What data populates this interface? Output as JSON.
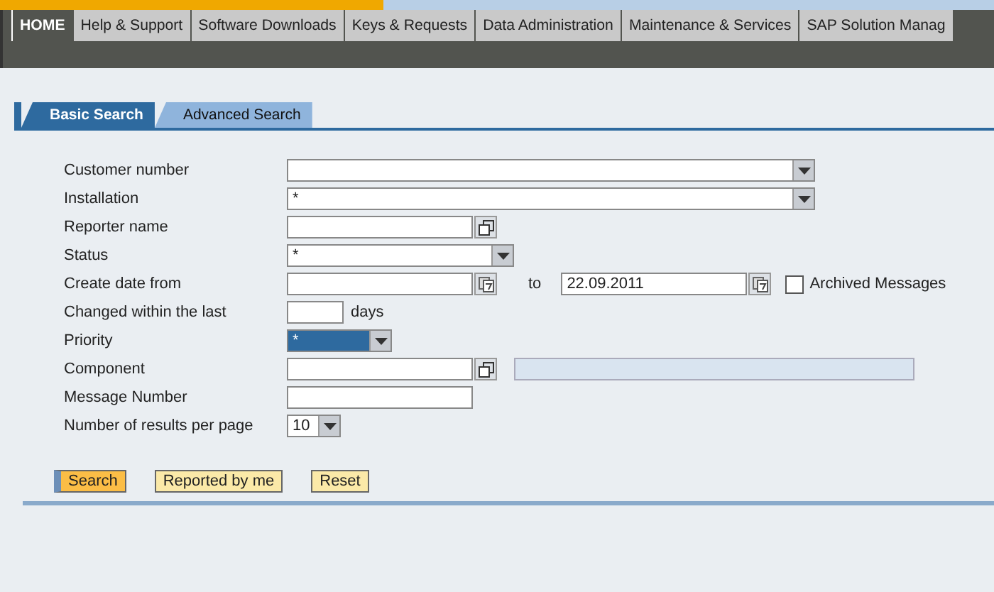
{
  "nav_tabs": [
    {
      "label": "HOME",
      "selected": true
    },
    {
      "label": "Help & Support",
      "selected": false
    },
    {
      "label": "Software Downloads",
      "selected": false
    },
    {
      "label": "Keys & Requests",
      "selected": false
    },
    {
      "label": "Data Administration",
      "selected": false
    },
    {
      "label": "Maintenance & Services",
      "selected": false
    },
    {
      "label": "SAP Solution Manag",
      "selected": false
    }
  ],
  "search_tabs": [
    {
      "label": "Basic Search",
      "selected": true
    },
    {
      "label": "Advanced Search",
      "selected": false
    }
  ],
  "form_rows": [
    {
      "label": "Customer number",
      "kind": "wide-combo",
      "focused": false
    },
    {
      "label": "Installation",
      "kind": "wide-combo",
      "value": "*",
      "focused": false
    },
    {
      "label": "Reporter name",
      "kind": "help",
      "focused": false
    },
    {
      "label": "Status",
      "kind": "combo",
      "value": "*",
      "focused": false
    },
    {
      "label": "Create date from",
      "kind": "date-range",
      "to_label": "to",
      "to_value": "22.09.2011",
      "checkbox": {
        "label": "Archived Messages",
        "checked": false
      },
      "focused": false
    },
    {
      "label": "Changed within the last",
      "kind": "days",
      "unit": "days",
      "focused": false
    },
    {
      "label": "Priority",
      "kind": "small-combo",
      "value": "*",
      "focused": true
    },
    {
      "label": "Component",
      "kind": "help-description",
      "focused": false
    },
    {
      "label": "Message Number",
      "kind": "text",
      "focused": false
    },
    {
      "label": "Number of results per page",
      "kind": "tiny-combo",
      "value": "10",
      "focused": false
    }
  ],
  "buttons": [
    {
      "label": "Search",
      "kind": "primary"
    },
    {
      "label": "Reported by me",
      "kind": "normal"
    },
    {
      "label": "Reset",
      "kind": "normal"
    }
  ]
}
